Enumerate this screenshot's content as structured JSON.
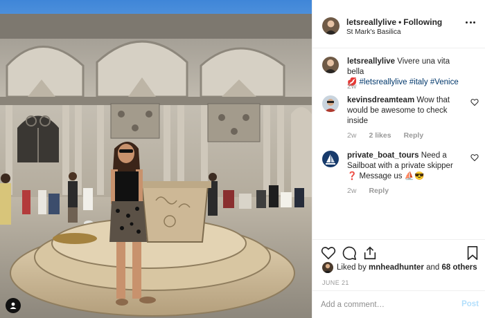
{
  "post": {
    "header": {
      "username": "letsreallylive",
      "separator": "•",
      "follow_status": "Following",
      "location": "St Mark's Basilica"
    },
    "caption": {
      "username": "letsreallylive",
      "text": "Vivere una vita bella",
      "emoji": "💋",
      "hashtags": [
        "#letsreallylive",
        "#italy",
        "#Venice"
      ],
      "time": "2w"
    },
    "comments": [
      {
        "username": "kevinsdreamteam",
        "text": "Wow that would be awesome to check inside",
        "time": "2w",
        "likes": "2 likes",
        "reply": "Reply"
      },
      {
        "username": "private_boat_tours",
        "text": "Need a Sailboat with a private skipper",
        "text2": "Message us",
        "emoji_before": "❓",
        "emoji_after": "⛵😎",
        "time": "2w",
        "reply": "Reply"
      }
    ],
    "likes": {
      "prefix": "Liked by",
      "user": "mnheadhunter",
      "connector": "and",
      "others": "68 others"
    },
    "date": "JUNE 21",
    "add_comment": {
      "placeholder": "Add a comment…",
      "post_label": "Post"
    }
  },
  "icons": {
    "more": "more-options-icon",
    "heart": "heart-icon",
    "comment": "comment-icon",
    "share": "share-icon",
    "save": "bookmark-icon",
    "user_tag": "user-tag-icon"
  },
  "colors": {
    "link": "#00376b",
    "muted": "#999999",
    "post_disabled": "#b2dffc",
    "border": "#efefef"
  }
}
